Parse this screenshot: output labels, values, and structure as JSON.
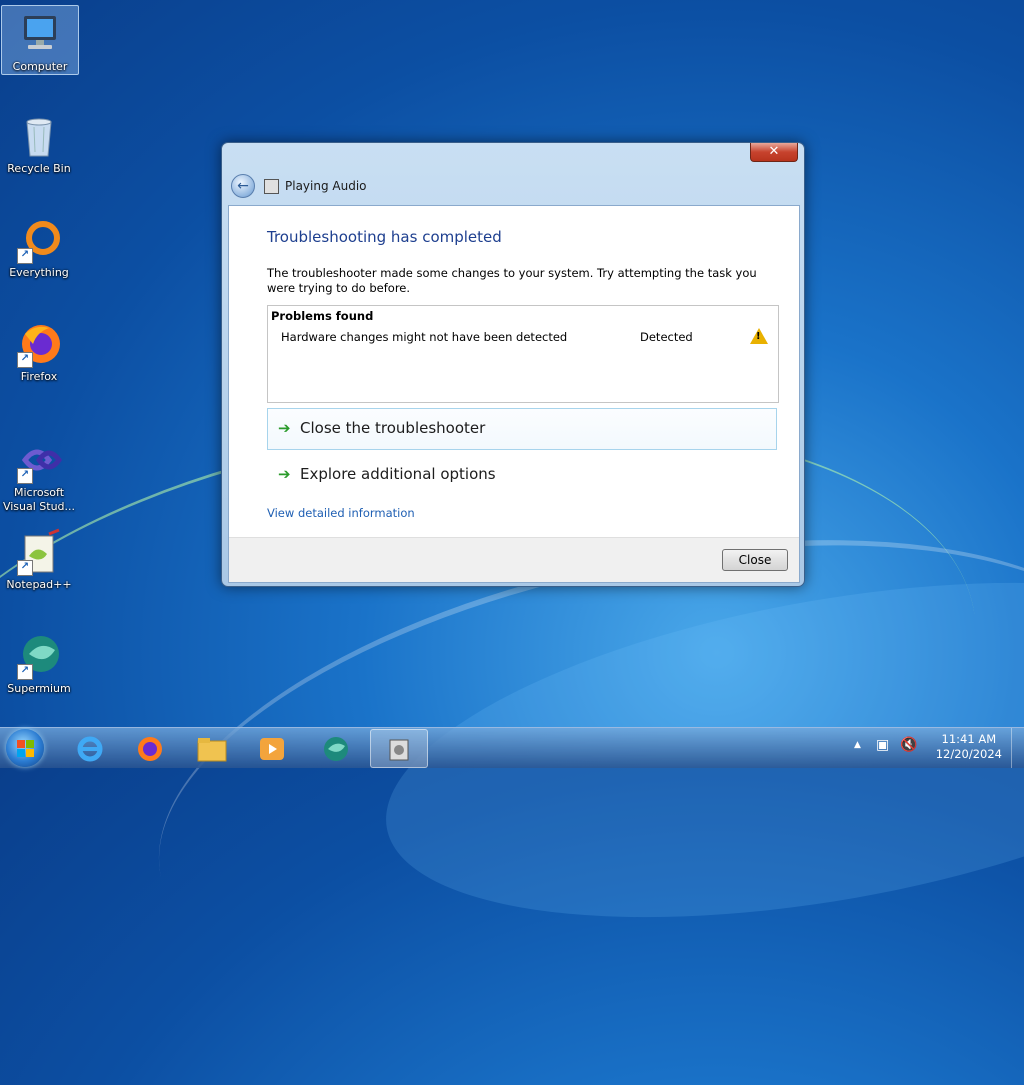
{
  "desktop": {
    "icons": [
      {
        "label": "Computer"
      },
      {
        "label": "Recycle Bin"
      },
      {
        "label": "Everything"
      },
      {
        "label": "Firefox"
      },
      {
        "label": "Microsoft Visual Stud..."
      },
      {
        "label": "Notepad++"
      },
      {
        "label": "Supermium"
      }
    ]
  },
  "dialog": {
    "title": "Playing Audio",
    "close_glyph": "✕",
    "heading": "Troubleshooting has completed",
    "description": "The troubleshooter made some changes to your system. Try attempting the task you were trying to do before.",
    "problems_header": "Problems found",
    "problems": [
      {
        "name": "Hardware changes might not have been detected",
        "status": "Detected"
      }
    ],
    "options": [
      {
        "label": "Close the troubleshooter"
      },
      {
        "label": "Explore additional options"
      }
    ],
    "detail_link": "View detailed information",
    "close_button": "Close"
  },
  "taskbar": {
    "clock_time": "11:41 AM",
    "clock_date": "12/20/2024"
  }
}
